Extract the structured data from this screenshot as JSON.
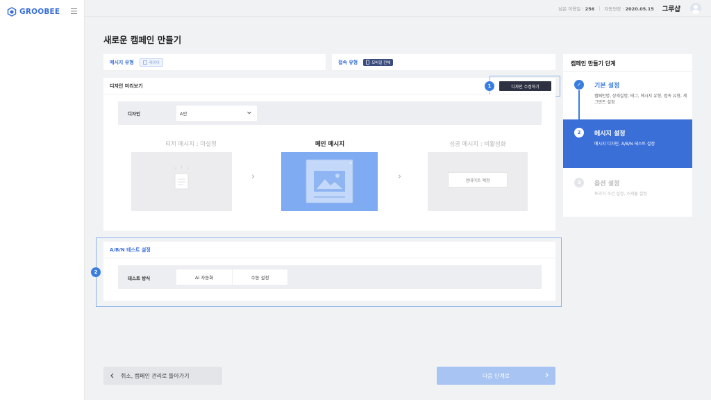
{
  "brand": {
    "name": "GROOBEE",
    "accent": "#3a7de0"
  },
  "topbar": {
    "usage_label": "남은 이용일 :",
    "usage_value": "256",
    "separator": "|",
    "expire_label": "자동연장 :",
    "expire_value": "2020.05.15",
    "username": "그루샵"
  },
  "page": {
    "title": "새로운 캠페인 만들기"
  },
  "type_row": {
    "message_type_label": "메시지 유형",
    "message_type_value": "레이어",
    "access_type_label": "접속 유형",
    "access_type_value": "모바일 전체"
  },
  "preview": {
    "title": "디자인 미리보기",
    "edit_button": "디자인 수정하기",
    "badge1": "1",
    "design_label": "디자인",
    "design_value": "A안",
    "teaser_title": "티저 메시지 : 미설정",
    "main_title": "메인 메시지",
    "success_title": "성공 메시지 : 비활성화",
    "update_label": "업데이트 예정"
  },
  "ab_test": {
    "title": "A/B/N 테스트 설정",
    "badge2": "2",
    "method_label": "테스트 방식",
    "options": [
      "AI 자동화",
      "수동 설정"
    ]
  },
  "steps": {
    "title": "캠페인 만들기 단계",
    "items": [
      {
        "number": "✓",
        "title": "기본 설정",
        "desc": "캠페인명, 상세설명, 태그, 메시지 유형, 접속 유형, 세그먼트 설정",
        "state": "done"
      },
      {
        "number": "2",
        "title": "메시지 설정",
        "desc": "메시지 디자인, A/B/N 테스트 설정",
        "state": "active"
      },
      {
        "number": "3",
        "title": "옵션 설정",
        "desc": "트리거 조건 설정, 스케쥴 설정",
        "state": "pending"
      }
    ]
  },
  "footer": {
    "cancel_label": "취소, 캠페인 관리로 돌아가기",
    "next_label": "다음 단계로"
  }
}
